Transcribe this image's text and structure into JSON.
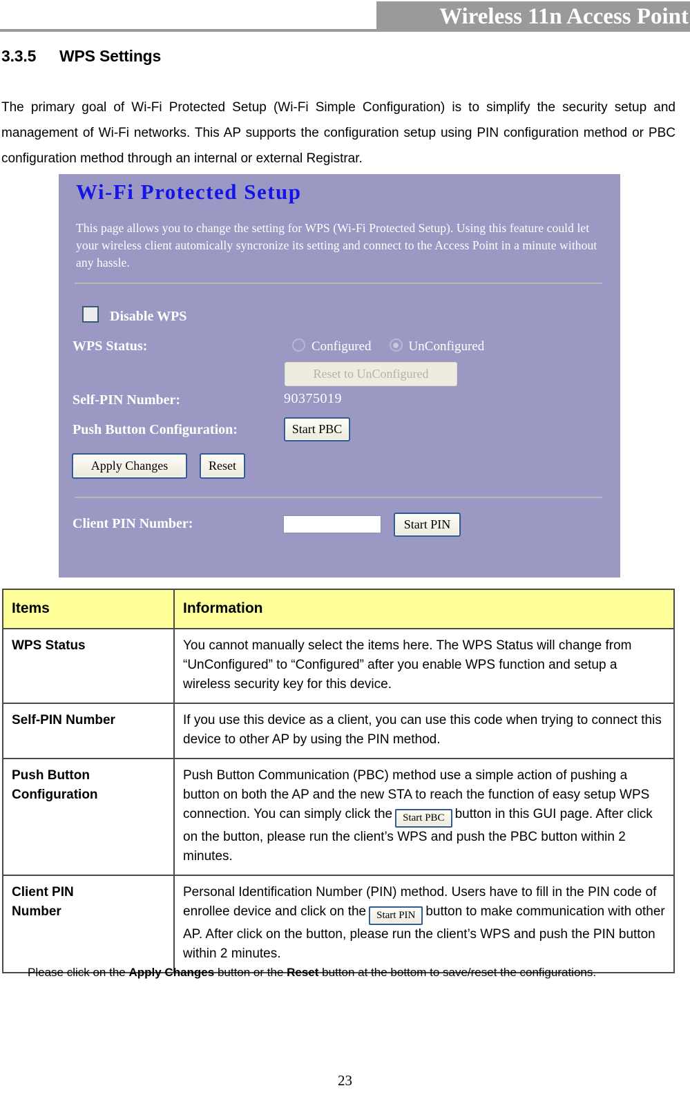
{
  "header": {
    "banner_title": "Wireless 11n Access Point"
  },
  "section": {
    "number": "3.3.5",
    "title": "WPS Settings",
    "intro": "The primary goal of Wi-Fi Protected Setup (Wi-Fi Simple Configuration) is to simplify the security setup and management of Wi-Fi networks. This AP supports the configuration setup using PIN configuration method or PBC configuration method through an internal or external Registrar."
  },
  "screenshot": {
    "title": "Wi-Fi Protected Setup",
    "description": "This page allows you to change the setting for WPS (Wi-Fi Protected Setup). Using this feature could let your wireless client automically syncronize its setting and connect to the Access Point in a minute without any hassle.",
    "disable_wps_label": "Disable WPS",
    "disable_wps_checked": false,
    "wps_status_label": "WPS Status:",
    "radio_configured": "Configured",
    "radio_unconfigured": "UnConfigured",
    "radio_selected": "UnConfigured",
    "reset_to_unconfigured_button": "Reset to UnConfigured",
    "self_pin_label": "Self-PIN Number:",
    "self_pin_value": "90375019",
    "pbc_label": "Push Button Configuration:",
    "start_pbc_button": "Start PBC",
    "apply_changes_button": "Apply Changes",
    "reset_button": "Reset",
    "client_pin_label": "Client PIN Number:",
    "client_pin_value": "",
    "client_pin_placeholder": "",
    "start_pin_button": "Start PIN",
    "panel_bg_color": "#9b98c3",
    "title_color": "#1414e6"
  },
  "table": {
    "header_bg_color": "#ffff99",
    "columns": [
      "Items",
      "Information"
    ],
    "rows": [
      {
        "item": "WPS Status",
        "info": "You cannot manually select the items here. The WPS Status will change from “UnConfigured” to “Configured” after you enable WPS function and setup a wireless security key for this device."
      },
      {
        "item": "Self-PIN Number",
        "info": "If you use this device as a client, you can use this code when trying to connect this device to other AP by using the PIN method."
      },
      {
        "item": "Push Button\nConfiguration",
        "info_part1": "Push Button Communication (PBC) method use a simple action of pushing a button on both the AP and the new STA to reach the function of easy setup WPS connection. You can simply click the",
        "inline_button": "Start PBC",
        "info_part2": "button in this GUI page. After click on the button, please run the client’s WPS and push the PBC button within 2 minutes."
      },
      {
        "item": "Client PIN\nNumber",
        "info_part1": "Personal Identification Number (PIN) method. Users have to fill in the PIN code of enrollee device and click on the",
        "inline_button": "Start PIN",
        "info_part2": "button to make communication with other AP. After click on the button, please run the client’s WPS and push the PIN button within 2 minutes."
      }
    ]
  },
  "footer": {
    "note_prefix": "Please click on the ",
    "note_bold1": "Apply Changes",
    "note_mid": " button or the ",
    "note_bold2": "Reset",
    "note_suffix": " button at the bottom to save/reset the configurations.",
    "page_number": "23"
  }
}
